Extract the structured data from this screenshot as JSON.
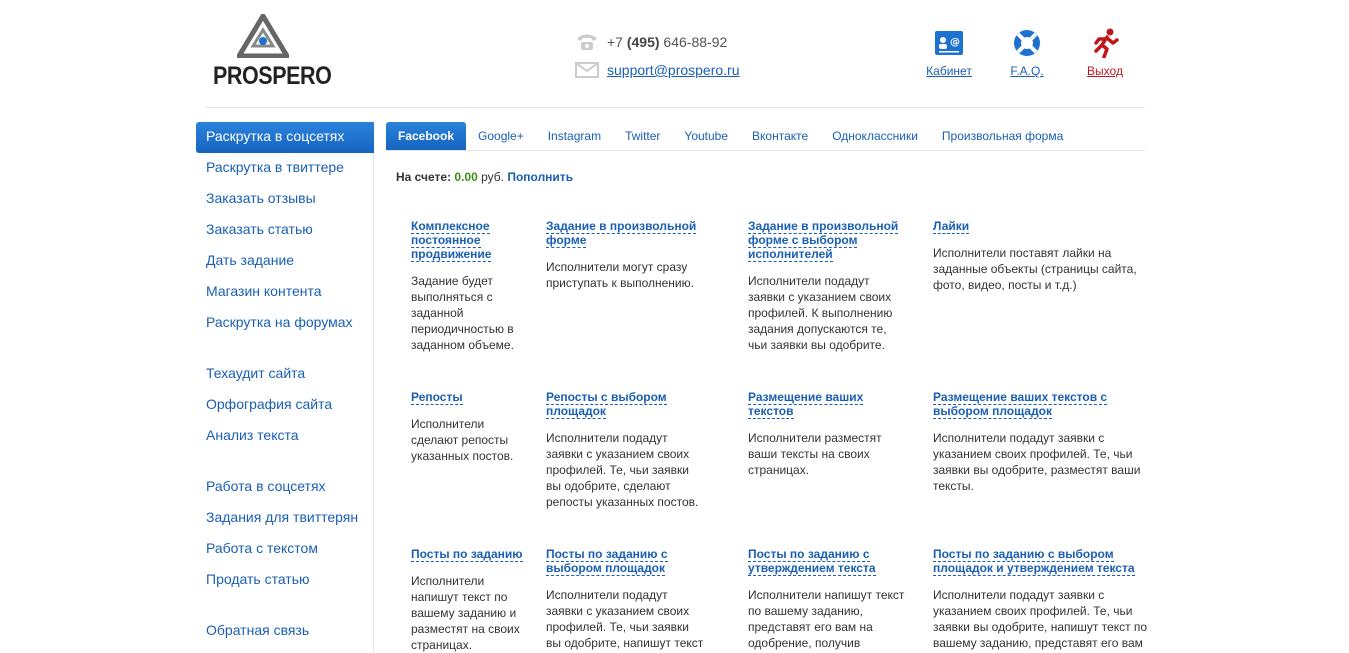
{
  "header": {
    "logo_text": "PROSPERO",
    "phone_prefix": "+7 ",
    "phone_code": "(495)",
    "phone_number": " 646-88-92",
    "email": "support@prospero.ru",
    "nav": [
      {
        "label": "Кабинет",
        "icon": "cabinet-icon"
      },
      {
        "label": "F.A.Q.",
        "icon": "lifebuoy-icon"
      },
      {
        "label": "Выход",
        "icon": "exit-runner-icon"
      }
    ]
  },
  "sidebar": {
    "groups": [
      [
        "Раскрутка в соцсетях",
        "Раскрутка в твиттере",
        "Заказать отзывы",
        "Заказать статью",
        "Дать задание",
        "Магазин контента",
        "Раскрутка на форумах"
      ],
      [
        "Техаудит сайта",
        "Орфография сайта",
        "Анализ текста"
      ],
      [
        "Работа в соцсетях",
        "Задания для твиттерян",
        "Работа с текстом",
        "Продать статью"
      ],
      [
        "Обратная связь"
      ]
    ],
    "active": "Раскрутка в соцсетях"
  },
  "tabs": [
    "Facebook",
    "Google+",
    "Instagram",
    "Twitter",
    "Youtube",
    "Вконтакте",
    "Одноклассники",
    "Произвольная форма"
  ],
  "balance": {
    "label": "На счете: ",
    "amount": "0.00",
    "currency": " руб. ",
    "topup": "Пополнить"
  },
  "cards": [
    [
      {
        "title": "Комплексное постоянное продвижение",
        "desc": "Задание будет выполняться с заданной периодичностью в заданном объеме."
      },
      {
        "title": "Задание в произвольной форме",
        "desc": "Исполнители могут сразу приступать к выполнению."
      },
      {
        "title": "Задание в произвольной форме с выбором исполнителей",
        "desc": "Исполнители подадут заявки с указанием своих профилей. К выполнению задания допускаются те, чьи заявки вы одобрите."
      },
      {
        "title": "Лайки",
        "desc": "Исполнители поставят лайки на заданные объекты (страницы сайта, фото, видео, посты и т.д.)"
      }
    ],
    [
      {
        "title": "Репосты",
        "desc": "Исполнители сделают репосты указанных постов."
      },
      {
        "title": "Репосты с выбором площадок",
        "desc": "Исполнители подадут заявки с указанием своих профилей. Те, чьи заявки вы одобрите, сделают репосты указанных постов."
      },
      {
        "title": "Размещение ваших текстов",
        "desc": "Исполнители разместят ваши тексты на своих страницах."
      },
      {
        "title": "Размещение ваших текстов с выбором площадок",
        "desc": "Исполнители подадут заявки с указанием своих профилей. Те, чьи заявки вы одобрите, разместят ваши тексты."
      }
    ],
    [
      {
        "title": "Посты по заданию",
        "desc": "Исполнители напишут текст по вашему заданию и разместят на своих страницах."
      },
      {
        "title": "Посты по заданию с выбором площадок",
        "desc": "Исполнители подадут заявки с указанием своих профилей. Те, чьи заявки вы одобрите, напишут текст по вашему заданию и разместят его."
      },
      {
        "title": "Посты по заданию с утверждением текста",
        "desc": "Исполнители напишут текст по вашему заданию, представят его вам на одобрение, получив одобрение разместят."
      },
      {
        "title": "Посты по заданию с выбором площадок и утверждением текста",
        "desc": "Исполнители подадут заявки с указанием своих профилей. Те, чьи заявки вы одобрите, напишут текст по вашему заданию, представят его вам на одобрение."
      }
    ]
  ],
  "colors": {
    "accent": "#1a5fb4",
    "active_tab": "#1e72cf",
    "money": "#3a8f16",
    "exit": "#c0161b"
  }
}
